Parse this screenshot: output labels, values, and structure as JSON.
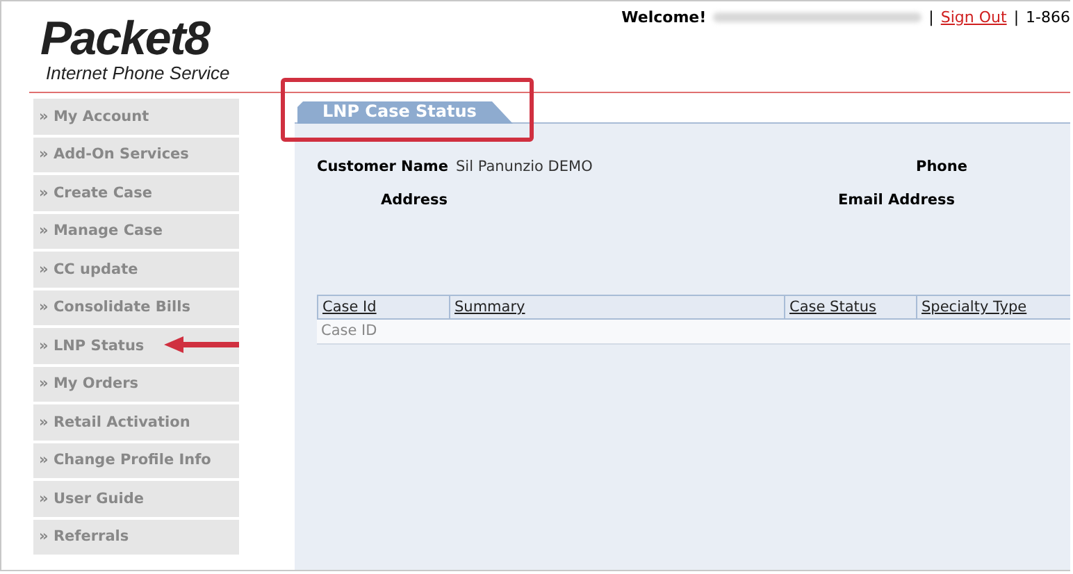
{
  "header": {
    "logo": {
      "name": "Packet8",
      "tagline": "Internet Phone Service"
    },
    "welcome": "Welcome!",
    "separator_1": "|",
    "sign_out": "Sign Out",
    "separator_2": "|",
    "phone": "1-866"
  },
  "sidebar": {
    "items": [
      {
        "label": "» My Account"
      },
      {
        "label": "» Add-On Services"
      },
      {
        "label": "» Create Case"
      },
      {
        "label": "» Manage Case"
      },
      {
        "label": "» CC update"
      },
      {
        "label": "» Consolidate Bills"
      },
      {
        "label": "» LNP Status",
        "annotated": true
      },
      {
        "label": "» My Orders"
      },
      {
        "label": "» Retail Activation"
      },
      {
        "label": "» Change Profile Info"
      },
      {
        "label": "» User Guide"
      },
      {
        "label": "» Referrals"
      }
    ]
  },
  "tab": {
    "label": "LNP Case Status",
    "annotated": true
  },
  "customer": {
    "name_label": "Customer Name",
    "name_value": "Sil Panunzio DEMO",
    "phone_label": "Phone",
    "address_label": "Address",
    "email_label": "Email Address"
  },
  "table": {
    "columns": [
      "Case Id",
      "Summary",
      "Case Status",
      "Specialty Type"
    ],
    "rows": [
      [
        "Case ID",
        "",
        "",
        ""
      ]
    ]
  }
}
